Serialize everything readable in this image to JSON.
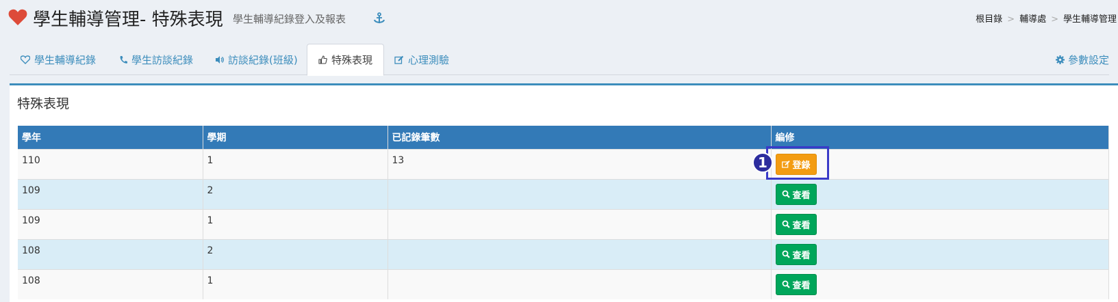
{
  "header": {
    "title": "學生輔導管理- 特殊表現",
    "subtitle": "學生輔導紀錄登入及報表",
    "breadcrumb": [
      "根目錄",
      "輔導處",
      "學生輔導管理"
    ]
  },
  "tabs": [
    {
      "label": "學生輔導紀錄",
      "icon": "heart-outline-icon",
      "active": false
    },
    {
      "label": "學生訪談紀錄",
      "icon": "phone-icon",
      "active": false
    },
    {
      "label": "訪談紀錄(班級)",
      "icon": "volume-icon",
      "active": false
    },
    {
      "label": "特殊表現",
      "icon": "thumbs-up-icon",
      "active": true
    },
    {
      "label": "心理測驗",
      "icon": "edit-icon",
      "active": false
    }
  ],
  "settings_tab": {
    "label": "參數設定",
    "icon": "gear-icon"
  },
  "box": {
    "title": "特殊表現"
  },
  "table": {
    "headers": [
      "學年",
      "學期",
      "已記錄筆數",
      "編修"
    ],
    "rows": [
      {
        "year": "110",
        "term": "1",
        "count": "13",
        "action": "登錄",
        "action_type": "register"
      },
      {
        "year": "109",
        "term": "2",
        "count": "",
        "action": "查看",
        "action_type": "view"
      },
      {
        "year": "109",
        "term": "1",
        "count": "",
        "action": "查看",
        "action_type": "view"
      },
      {
        "year": "108",
        "term": "2",
        "count": "",
        "action": "查看",
        "action_type": "view"
      },
      {
        "year": "108",
        "term": "1",
        "count": "",
        "action": "查看",
        "action_type": "view"
      }
    ]
  },
  "annotation": {
    "step": "1"
  },
  "colors": {
    "accent": "#3c8dbc",
    "header_bg": "#337ab7",
    "warning": "#f39c12",
    "success": "#00a65a",
    "heart": "#dd4b39",
    "annotation": "#3a3ac8"
  }
}
